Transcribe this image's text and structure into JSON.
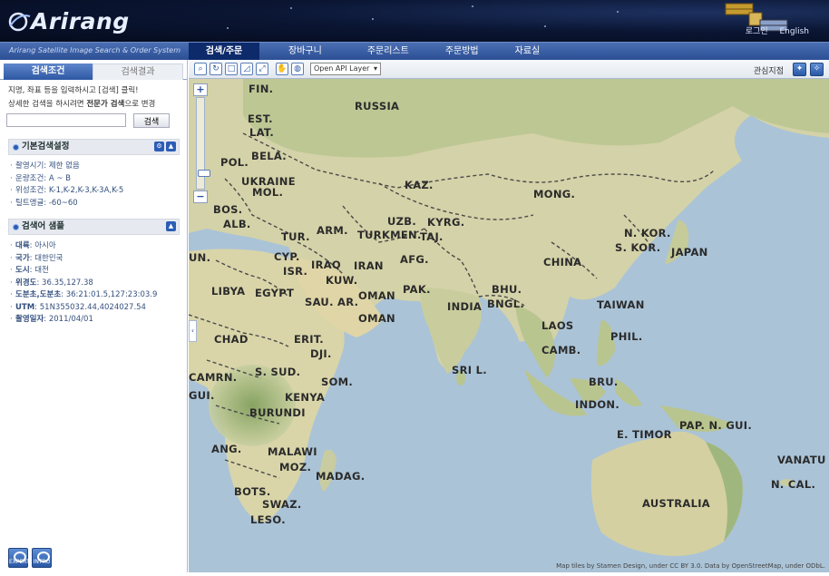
{
  "brand": {
    "logo_text": "Arirang",
    "subtitle": "Arirang Satellite Image Search & Order System"
  },
  "top_links": {
    "login": "로그인",
    "english": "English"
  },
  "nav": {
    "items": [
      "검색/주문",
      "장바구니",
      "주문리스트",
      "주문방법",
      "자료실"
    ],
    "active_index": 0
  },
  "left_panel": {
    "tabs": {
      "search_conditions": "검색조건",
      "search_results": "검색결과"
    },
    "intro_line1": "지명, 좌표 등을 입력하시고 [검색] 클릭!",
    "intro_line2_pre": "상세한 검색을 하시려면 ",
    "intro_line2_bold": "전문가 검색",
    "intro_line2_post": "으로 변경",
    "search_input_value": "",
    "search_button": "검색",
    "basic_settings": {
      "title": "기본검색설정",
      "items": [
        "촬영시기: 제한 없음",
        "운량조건: A ~ B",
        "위성조건: K-1,K-2,K-3,K-3A,K-5",
        "틸트앵글: -60~60"
      ]
    },
    "search_examples": {
      "title": "검색어 샘플",
      "items": [
        {
          "key": "대륙",
          "value": "아시아"
        },
        {
          "key": "국가",
          "value": "대한민국"
        },
        {
          "key": "도시",
          "value": "대전"
        },
        {
          "key": "위경도",
          "value": "36.35,127.38"
        },
        {
          "key": "도분초,도분초",
          "value": "36:21:01.5,127:23:03.9"
        },
        {
          "key": "UTM",
          "value": "51N355032.44,4024027.54"
        },
        {
          "key": "촬영일자",
          "value": "2011/04/01"
        }
      ]
    },
    "bottom_icons": [
      "EXPERT",
      "INTRO"
    ]
  },
  "toolbar": {
    "layer_select": "Open API Layer",
    "bookmark_label": "관심지점"
  },
  "map": {
    "attribution": "Map tiles by Stamen Design, under CC BY 3.0. Data by OpenStreetMap, under ODbL.",
    "zoom_level_fraction": 0.86,
    "labels": {
      "fin": "FIN.",
      "russia": "RUSSIA",
      "est": "EST.",
      "lat": "LAT.",
      "pol": "POL.",
      "bela": "BELA.",
      "ukraine": "UKRAINE",
      "mol": "MOL.",
      "kaz": "KAZ.",
      "mong": "MONG.",
      "bos": "BOS.",
      "alb": "ALB.",
      "arm": "ARM.",
      "uzb": "UZB.",
      "kyrg": "KYRG.",
      "tur": "TUR.",
      "turkmen": "TURKMEN.",
      "taj": "TAJ.",
      "nkor": "N. KOR.",
      "skor": "S. KOR.",
      "japan": "JAPAN",
      "un": "UN.",
      "cyp": "CYP.",
      "iraq": "IRAQ",
      "iran": "IRAN",
      "afg": "AFG.",
      "china": "CHINA",
      "isr": "ISR.",
      "kuw": "KUW.",
      "libya": "LIBYA",
      "egypt": "EGYPT",
      "pak": "PAK.",
      "saudi": "SAU. AR.",
      "oman1": "OMAN",
      "oman2": "OMAN",
      "bhu": "BHU.",
      "india": "INDIA",
      "bngl": "BNGL.",
      "taiwan": "TAIWAN",
      "laos": "LAOS",
      "chad": "CHAD",
      "erit": "ERIT.",
      "dji": "DJI.",
      "phil": "PHIL.",
      "camb": "CAMB.",
      "srilanka": "SRI L.",
      "camrn": "CAMRN.",
      "ssud": "S. SUD.",
      "som": "SOM.",
      "gui": "GUI.",
      "kenya": "KENYA",
      "bru": "BRU.",
      "indon": "INDON.",
      "burundi": "BURUNDI",
      "papng": "PAP. N. GUI.",
      "etimor": "E. TIMOR",
      "ang": "ANG.",
      "malawi": "MALAWI",
      "moz": "MOZ.",
      "vanatu": "VANATU",
      "madag": "MADAG.",
      "ncal": "N. CAL.",
      "bots": "BOTS.",
      "australia": "AUSTRALIA",
      "swaz": "SWAZ.",
      "leso": "LESO."
    }
  }
}
